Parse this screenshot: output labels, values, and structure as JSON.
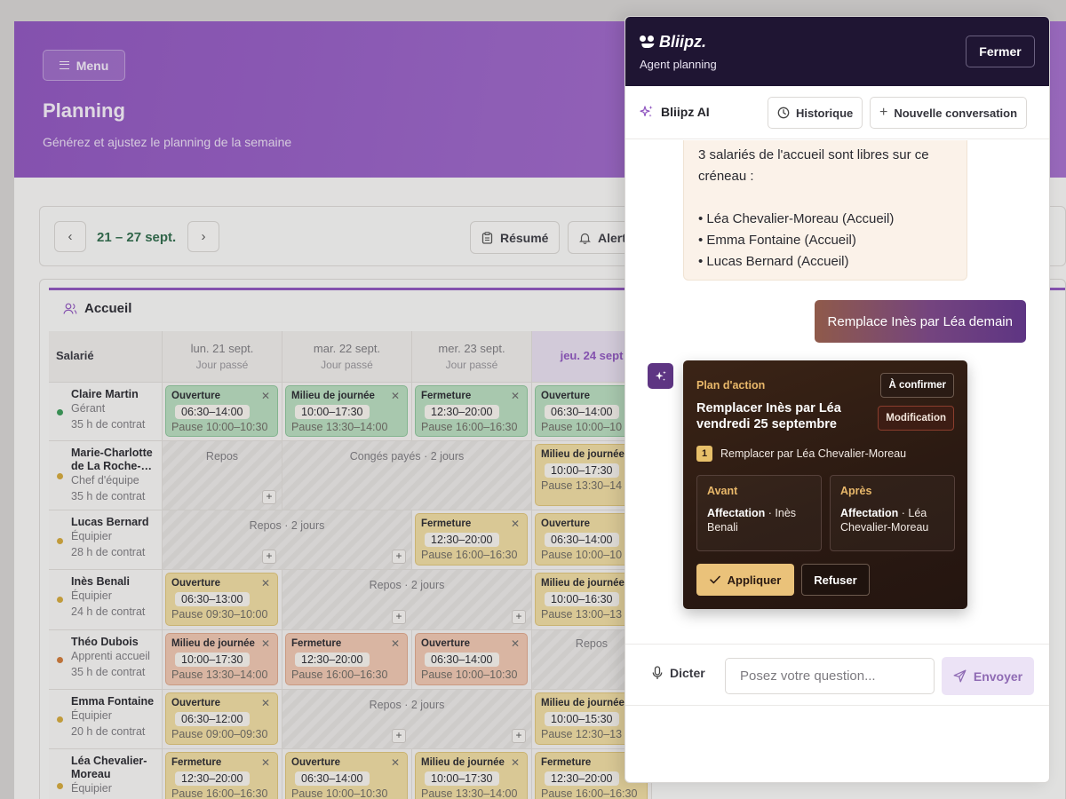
{
  "app": {
    "menu_label": "Menu",
    "title": "Planning",
    "subtitle": "Générez et ajustez le planning de la semaine",
    "week": "21 – 27 sept.",
    "summary_label": "Résumé",
    "alerts_label": "Alert",
    "team_title": "Accueil",
    "col_employee": "Salarié",
    "days": [
      {
        "label": "lun. 21 sept.",
        "sub": "Jour passé"
      },
      {
        "label": "mar. 22 sept.",
        "sub": "Jour passé"
      },
      {
        "label": "mer. 23 sept.",
        "sub": "Jour passé"
      },
      {
        "label": "jeu. 24 sept",
        "sub": ""
      }
    ],
    "employees": [
      {
        "name": "Claire Martin",
        "role": "Gérant",
        "hours": "35 h de contrat",
        "dot": "#3a9a58"
      },
      {
        "name": "Marie-Charlotte de La Roche-…",
        "role": "Chef d'équipe",
        "hours": "35 h de contrat",
        "dot": "#d4a93c"
      },
      {
        "name": "Lucas Bernard",
        "role": "Équipier",
        "hours": "28 h de contrat",
        "dot": "#d4a93c"
      },
      {
        "name": "Inès Benali",
        "role": "Équipier",
        "hours": "24 h de contrat",
        "dot": "#d4a93c"
      },
      {
        "name": "Théo Dubois",
        "role": "Apprenti accueil",
        "hours": "35 h de contrat",
        "dot": "#d07a3a"
      },
      {
        "name": "Emma Fontaine",
        "role": "Équipier",
        "hours": "20 h de contrat",
        "dot": "#d4a93c"
      },
      {
        "name": "Léa Chevalier-Moreau",
        "role": "Équipier",
        "hours": "",
        "dot": "#d4a93c"
      }
    ],
    "shifts": {
      "ouverture": "Ouverture",
      "milieu": "Milieu de journée",
      "fermeture": "Fermeture",
      "t_0630_1400": "06:30–14:00",
      "t_1000_1730": "10:00–17:30",
      "t_1230_2000": "12:30–20:00",
      "t_0630_1300": "06:30–13:00",
      "t_1000_1630": "10:00–16:30",
      "t_0630_1200": "06:30–12:00",
      "t_1000_1530": "10:00–15:30",
      "p_1000_1030": "Pause 10:00–10:30",
      "p_1330_1400": "Pause 13:30–14:00",
      "p_1600_1630": "Pause 16:00–16:30",
      "p_0930_1000": "Pause 09:30–10:00",
      "p_0900_0930": "Pause 09:00–09:30",
      "p_1330_14_trunc": "Pause 13:30–14",
      "p_1000_10_trunc": "Pause 10:00–10",
      "p_1300_13_trunc": "Pause 13:00–13",
      "p_1230_13_trunc": "Pause 12:30–13",
      "repos": "Repos",
      "conges": "Congés payés · 2 jours",
      "repos2": "Repos · 2 jours",
      "milieu_trunc": "Milieu de journée"
    }
  },
  "panel": {
    "brand": "Bliipz.",
    "subtitle": "Agent planning",
    "close_label": "Fermer",
    "ai_title": "Bliipz AI",
    "history_label": "Historique",
    "new_conv_label": "Nouvelle conversation",
    "bot_message": {
      "intro_1": "3 salariés de l'accueil sont libres sur ce",
      "intro_2": "créneau :",
      "items": [
        "• Léa Chevalier-Moreau (Accueil)",
        "• Emma Fontaine (Accueil)",
        "• Lucas Bernard (Accueil)"
      ]
    },
    "user_message": "Remplace Inès par Léa demain",
    "action": {
      "kicker": "Plan d'action",
      "title": "Remplacer Inès par Léa vendredi 25 septembre",
      "badge_confirm": "À confirmer",
      "badge_modif": "Modification",
      "step_num": "1",
      "step_text": "Remplacer par Léa Chevalier-Moreau",
      "before_title": "Avant",
      "before_key": "Affectation",
      "before_val": " · Inès Benali",
      "after_title": "Après",
      "after_key": "Affectation",
      "after_val": " · Léa Chevalier-Moreau",
      "apply_label": "Appliquer",
      "refuse_label": "Refuser"
    },
    "dictate_label": "Dicter",
    "input_placeholder": "Posez votre question...",
    "send_label": "Envoyer"
  },
  "colors": {
    "brand_purple": "#8f55bf",
    "panel_header": "#1f1533",
    "accent_gold": "#eac27a"
  }
}
